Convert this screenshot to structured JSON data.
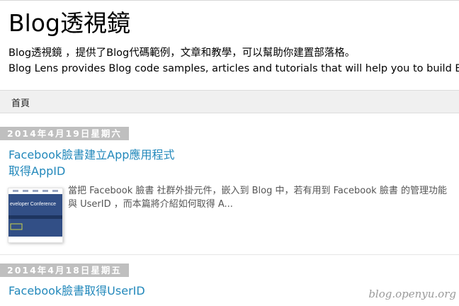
{
  "header": {
    "blog_title": "Blog透視鏡",
    "description_zh": "Blog透視鏡 ，提供了Blog代碼範例，文章和教學，可以幫助你建置部落格。",
    "description_en": "Blog Lens provides Blog code samples, articles and tutorials that will help you to build Blog."
  },
  "nav": {
    "home_tab": "首頁"
  },
  "posts": [
    {
      "date": "2014年4月19日星期六",
      "title_line1": "Facebook臉書建立App應用程式",
      "title_line2": "取得AppID",
      "thumbnail_text": "eveloper Conference",
      "snippet_line1": "當把 Facebook 臉書 社群外掛元件，嵌入到 Blog 中，若有用到 Facebook 臉書 的管理功能",
      "snippet_line2": "與 UserID ，而本篇將介紹如何取得 A..."
    },
    {
      "date": "2014年4月18日星期五",
      "title": "Facebook臉書取得UserID"
    }
  ],
  "watermark": "blog.openyu.org",
  "colors": {
    "link": "#2288bb",
    "date_header_bg": "#bfbfbf",
    "tab_bar_bg": "#f0f0f0"
  }
}
